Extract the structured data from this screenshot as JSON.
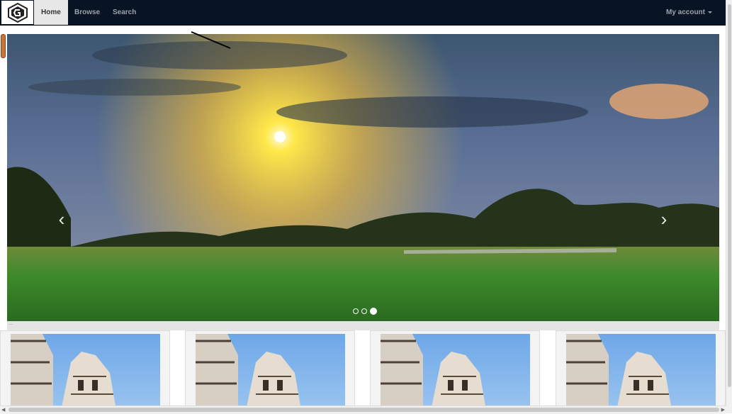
{
  "nav": {
    "brand_alt": "G",
    "items": [
      "Home",
      "Browse",
      "Search"
    ],
    "active": "Home",
    "account": "My account"
  },
  "carousel": {
    "slides": 3,
    "active_slide": 3,
    "prev_glyph": "‹",
    "next_glyph": "›"
  },
  "strip": {
    "text": "..."
  },
  "cards": [
    {
      "name": "card-1"
    },
    {
      "name": "card-2"
    },
    {
      "name": "card-3"
    },
    {
      "name": "card-4"
    }
  ],
  "colors": {
    "navbar": "#081423",
    "nav_active_bg": "#e7e7e7",
    "nav_text": "#9aa3ad"
  }
}
